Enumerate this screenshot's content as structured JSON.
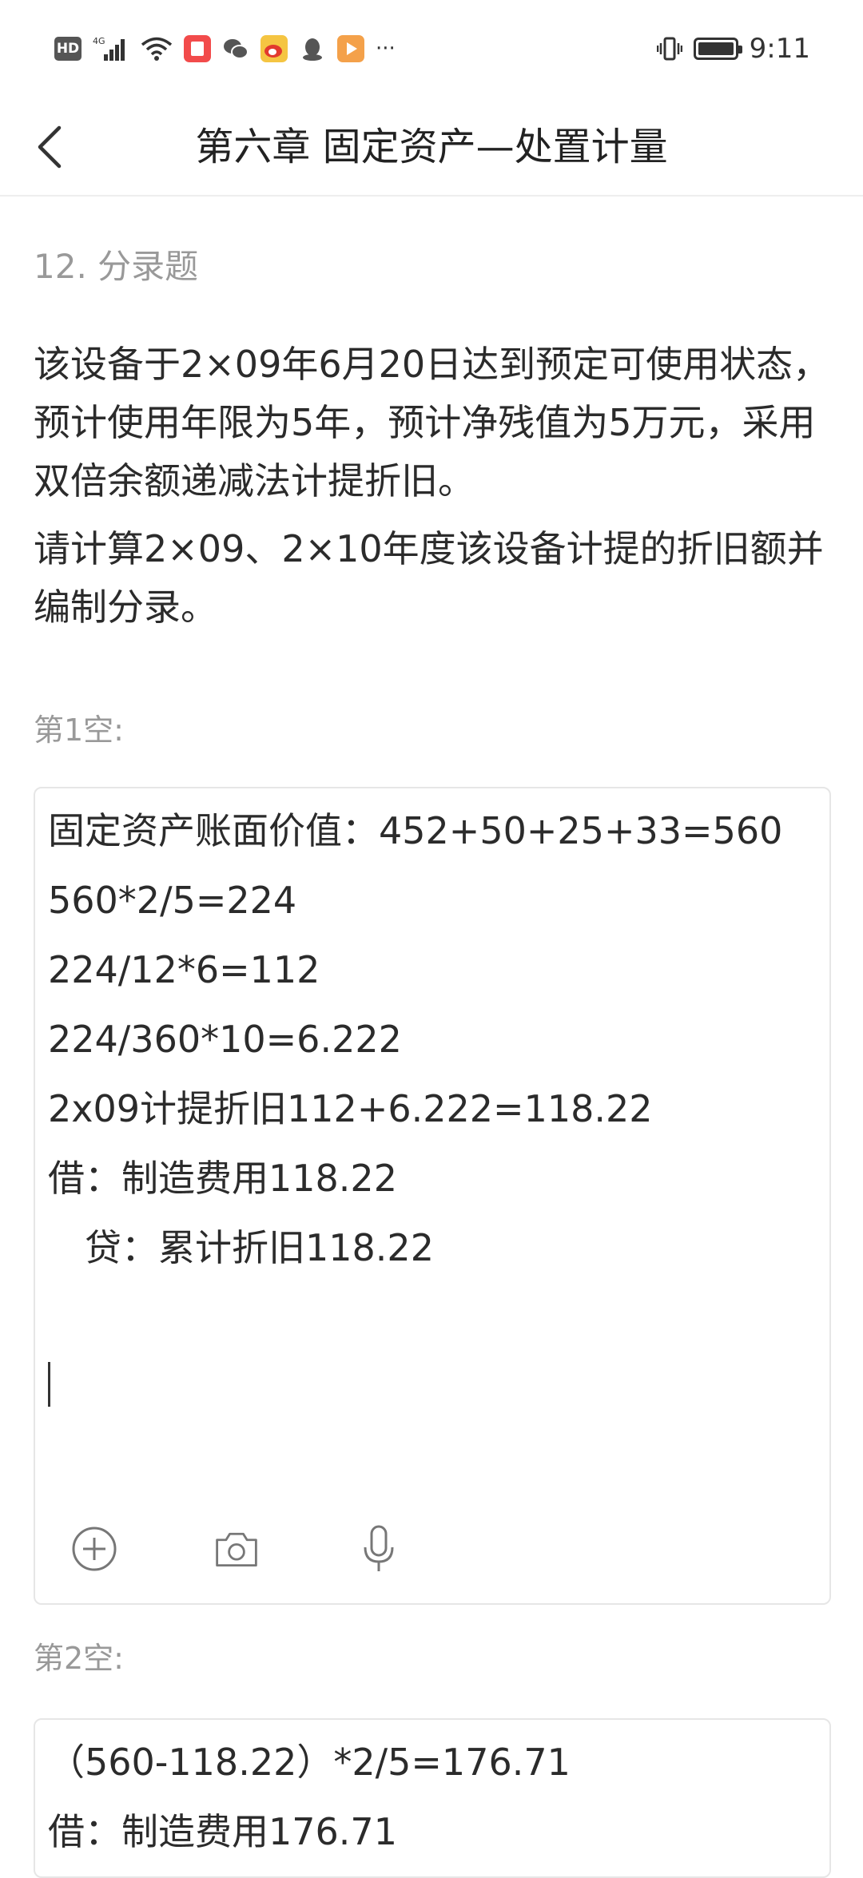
{
  "status_bar": {
    "hd": "HD",
    "network": "4G",
    "time": "9:11",
    "more": "···",
    "app_colors": [
      "#f24b4b",
      "#555555",
      "#f5c542",
      "#555555",
      "#f4a14a"
    ]
  },
  "nav": {
    "title": "第六章 固定资产—处置计量"
  },
  "question": {
    "type": "12. 分录题",
    "paragraphs": [
      "该设备于2×09年6月20日达到预定可使用状态，预计使用年限为5年，预计净残值为5万元，采用双倍余额递减法计提折旧。",
      "请计算2×09、2×10年度该设备计提的折旧额并编制分录。"
    ]
  },
  "blanks": [
    {
      "label": "第1空:",
      "answer": "固定资产账面价值：452+50+25+33=560\n560*2/5=224\n224/12*6=112\n224/360*10=6.222\n2x09计提折旧112+6.222=118.22\n借：制造费用118.22\n　贷：累计折旧118.22"
    },
    {
      "label": "第2空:",
      "answer": "（560-118.22）*2/5=176.71\n借：制造费用176.71"
    }
  ]
}
